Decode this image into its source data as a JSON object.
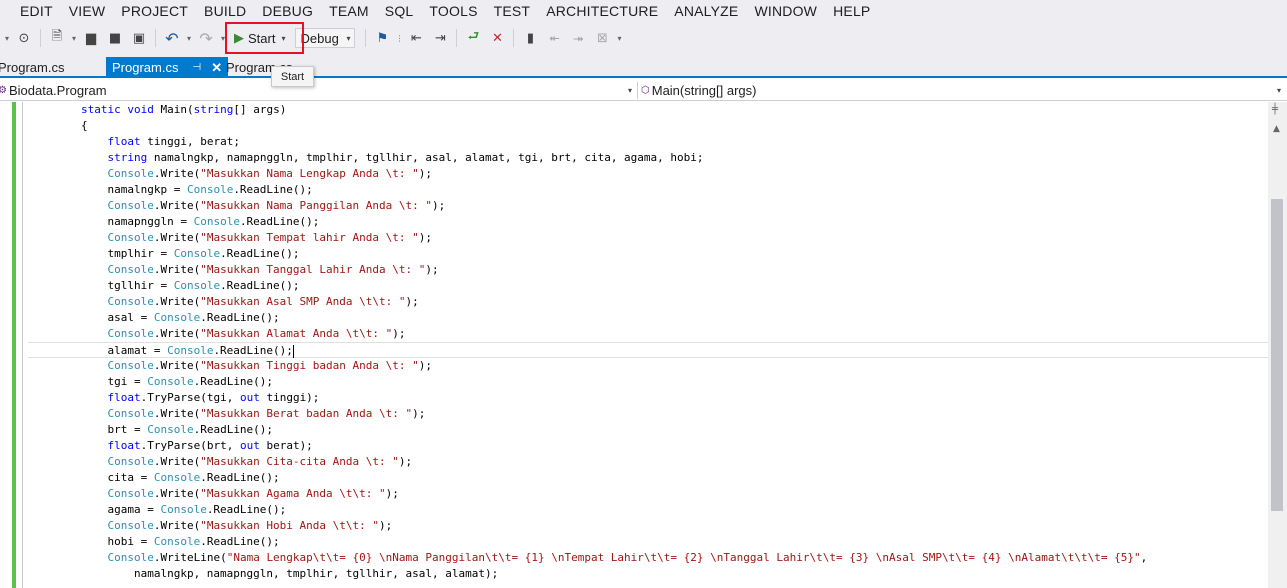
{
  "menu": [
    "EDIT",
    "VIEW",
    "PROJECT",
    "BUILD",
    "DEBUG",
    "TEAM",
    "SQL",
    "TOOLS",
    "TEST",
    "ARCHITECTURE",
    "ANALYZE",
    "WINDOW",
    "HELP"
  ],
  "toolbar": {
    "start_label": "Start",
    "configuration": "Debug",
    "accent_color": "#e81123",
    "play_color": "#388a34"
  },
  "tabs": {
    "left_tab": "Program.cs",
    "active_tab": "Program.cs",
    "right_tab": "Program.cs",
    "active_color": "#007acc"
  },
  "tooltip": "Start",
  "navigation": {
    "type_dropdown": "Biodata.Program",
    "member_dropdown": "Main(string[] args)"
  },
  "editor": {
    "lines": [
      [
        {
          "t": "        "
        },
        {
          "t": "static",
          "c": "kw"
        },
        {
          "t": " "
        },
        {
          "t": "void",
          "c": "kw"
        },
        {
          "t": " Main("
        },
        {
          "t": "string",
          "c": "kw"
        },
        {
          "t": "[] args)"
        }
      ],
      [
        {
          "t": "        {"
        }
      ],
      [
        {
          "t": "            "
        },
        {
          "t": "float",
          "c": "kw"
        },
        {
          "t": " tinggi, berat;"
        }
      ],
      [
        {
          "t": "            "
        },
        {
          "t": "string",
          "c": "kw"
        },
        {
          "t": " namalngkp, namapnggln, tmplhir, tgllhir, asal, alamat, tgi, brt, cita, agama, hobi;"
        }
      ],
      [
        {
          "t": "            "
        },
        {
          "t": "Console",
          "c": "ty"
        },
        {
          "t": ".Write("
        },
        {
          "t": "\"Masukkan Nama Lengkap Anda \\t: \"",
          "c": "str"
        },
        {
          "t": ");"
        }
      ],
      [
        {
          "t": "            namalngkp = "
        },
        {
          "t": "Console",
          "c": "ty"
        },
        {
          "t": ".ReadLine();"
        }
      ],
      [
        {
          "t": "            "
        },
        {
          "t": "Console",
          "c": "ty"
        },
        {
          "t": ".Write("
        },
        {
          "t": "\"Masukkan Nama Panggilan Anda \\t: \"",
          "c": "str"
        },
        {
          "t": ");"
        }
      ],
      [
        {
          "t": "            namapnggln = "
        },
        {
          "t": "Console",
          "c": "ty"
        },
        {
          "t": ".ReadLine();"
        }
      ],
      [
        {
          "t": "            "
        },
        {
          "t": "Console",
          "c": "ty"
        },
        {
          "t": ".Write("
        },
        {
          "t": "\"Masukkan Tempat lahir Anda \\t: \"",
          "c": "str"
        },
        {
          "t": ");"
        }
      ],
      [
        {
          "t": "            tmplhir = "
        },
        {
          "t": "Console",
          "c": "ty"
        },
        {
          "t": ".ReadLine();"
        }
      ],
      [
        {
          "t": "            "
        },
        {
          "t": "Console",
          "c": "ty"
        },
        {
          "t": ".Write("
        },
        {
          "t": "\"Masukkan Tanggal Lahir Anda \\t: \"",
          "c": "str"
        },
        {
          "t": ");"
        }
      ],
      [
        {
          "t": "            tgllhir = "
        },
        {
          "t": "Console",
          "c": "ty"
        },
        {
          "t": ".ReadLine();"
        }
      ],
      [
        {
          "t": "            "
        },
        {
          "t": "Console",
          "c": "ty"
        },
        {
          "t": ".Write("
        },
        {
          "t": "\"Masukkan Asal SMP Anda \\t\\t: \"",
          "c": "str"
        },
        {
          "t": ");"
        }
      ],
      [
        {
          "t": "            asal = "
        },
        {
          "t": "Console",
          "c": "ty"
        },
        {
          "t": ".ReadLine();"
        }
      ],
      [
        {
          "t": "            "
        },
        {
          "t": "Console",
          "c": "ty"
        },
        {
          "t": ".Write("
        },
        {
          "t": "\"Masukkan Alamat Anda \\t\\t: \"",
          "c": "str"
        },
        {
          "t": ");"
        }
      ],
      [
        {
          "t": "            alamat = "
        },
        {
          "t": "Console",
          "c": "ty"
        },
        {
          "t": ".ReadLine();"
        }
      ],
      [
        {
          "t": "            "
        },
        {
          "t": "Console",
          "c": "ty"
        },
        {
          "t": ".Write("
        },
        {
          "t": "\"Masukkan Tinggi badan Anda \\t: \"",
          "c": "str"
        },
        {
          "t": ");"
        }
      ],
      [
        {
          "t": "            tgi = "
        },
        {
          "t": "Console",
          "c": "ty"
        },
        {
          "t": ".ReadLine();"
        }
      ],
      [
        {
          "t": "            "
        },
        {
          "t": "float",
          "c": "kw"
        },
        {
          "t": ".TryParse(tgi, "
        },
        {
          "t": "out",
          "c": "kw"
        },
        {
          "t": " tinggi);"
        }
      ],
      [
        {
          "t": "            "
        },
        {
          "t": "Console",
          "c": "ty"
        },
        {
          "t": ".Write("
        },
        {
          "t": "\"Masukkan Berat badan Anda \\t: \"",
          "c": "str"
        },
        {
          "t": ");"
        }
      ],
      [
        {
          "t": "            brt = "
        },
        {
          "t": "Console",
          "c": "ty"
        },
        {
          "t": ".ReadLine();"
        }
      ],
      [
        {
          "t": "            "
        },
        {
          "t": "float",
          "c": "kw"
        },
        {
          "t": ".TryParse(brt, "
        },
        {
          "t": "out",
          "c": "kw"
        },
        {
          "t": " berat);"
        }
      ],
      [
        {
          "t": "            "
        },
        {
          "t": "Console",
          "c": "ty"
        },
        {
          "t": ".Write("
        },
        {
          "t": "\"Masukkan Cita-cita Anda \\t: \"",
          "c": "str"
        },
        {
          "t": ");"
        }
      ],
      [
        {
          "t": "            cita = "
        },
        {
          "t": "Console",
          "c": "ty"
        },
        {
          "t": ".ReadLine();"
        }
      ],
      [
        {
          "t": "            "
        },
        {
          "t": "Console",
          "c": "ty"
        },
        {
          "t": ".Write("
        },
        {
          "t": "\"Masukkan Agama Anda \\t\\t: \"",
          "c": "str"
        },
        {
          "t": ");"
        }
      ],
      [
        {
          "t": "            agama = "
        },
        {
          "t": "Console",
          "c": "ty"
        },
        {
          "t": ".ReadLine();"
        }
      ],
      [
        {
          "t": "            "
        },
        {
          "t": "Console",
          "c": "ty"
        },
        {
          "t": ".Write("
        },
        {
          "t": "\"Masukkan Hobi Anda \\t\\t: \"",
          "c": "str"
        },
        {
          "t": ");"
        }
      ],
      [
        {
          "t": "            hobi = "
        },
        {
          "t": "Console",
          "c": "ty"
        },
        {
          "t": ".ReadLine();"
        }
      ],
      [
        {
          "t": "            "
        },
        {
          "t": "Console",
          "c": "ty"
        },
        {
          "t": ".WriteLine("
        },
        {
          "t": "\"Nama Lengkap\\t\\t= {0} \\nNama Panggilan\\t\\t= {1} \\nTempat Lahir\\t\\t= {2} \\nTanggal Lahir\\t\\t= {3} \\nAsal SMP\\t\\t= {4} \\nAlamat\\t\\t\\t= {5}\"",
          "c": "str"
        },
        {
          "t": ","
        }
      ],
      [
        {
          "t": "                namalngkp, namapnggln, tmplhir, tgllhir, asal, alamat);"
        }
      ]
    ],
    "current_line": 16,
    "gutter_color": "#5cc04c"
  }
}
